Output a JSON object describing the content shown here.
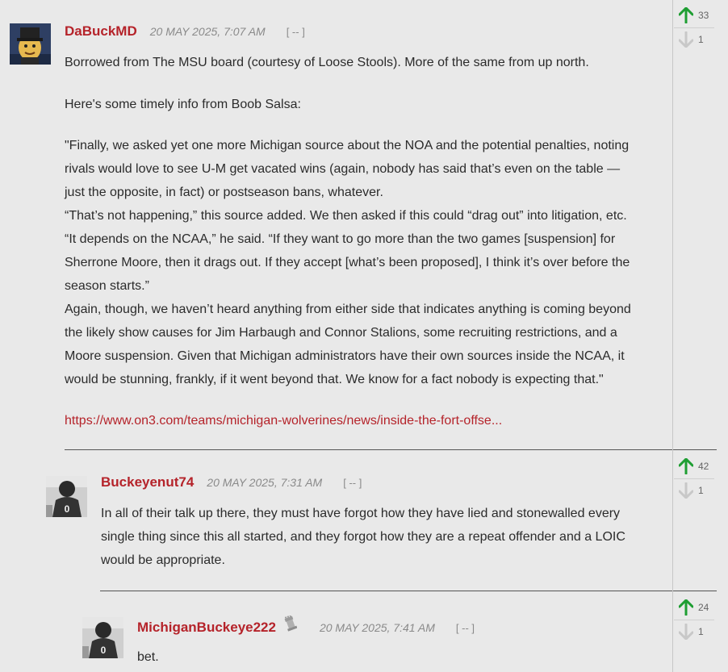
{
  "comments": [
    {
      "username": "DaBuckMD",
      "timestamp": "20 MAY 2025, 7:07 AM",
      "collapse": "[ -- ]",
      "paragraphs": [
        "Borrowed from The MSU board (courtesy of Loose Stools).  More of the same from up north.",
        "Here's some timely info from Boob Salsa:",
        "\"Finally, we asked yet one more Michigan source about the NOA and the potential penalties, noting rivals would love to see U-M get vacated wins (again, nobody has said that’s even on the table — just the opposite, in fact) or postseason bans, whatever.",
        "“That’s not happening,” this source added. We then asked if this could “drag out” into litigation, etc.",
        "“It depends on the NCAA,” he said. “If they want to go more than the two games [suspension] for Sherrone Moore, then it drags out. If they accept [what’s been proposed], I think it’s over before the season starts.”",
        "Again, though, we haven’t heard anything from either side that indicates anything is coming beyond the likely show causes for Jim Harbaugh and Connor Stalions, some recruiting restrictions, and a Moore suspension. Given that Michigan administrators have their own sources inside the NCAA, it would be stunning, frankly, if it went beyond that. We know for a fact nobody is expecting that.\""
      ],
      "link": "https://www.on3.com/teams/michigan-wolverines/news/inside-the-fort-offse...",
      "upvotes": "33",
      "downvotes": "1"
    },
    {
      "username": "Buckeyenut74",
      "timestamp": "20 MAY 2025, 7:31 AM",
      "collapse": "[ -- ]",
      "text": "In all of their talk up there, they must have forgot how they have lied and stonewalled every single thing since this all started, and they forgot how they are a repeat offender and a LOIC would be appropriate.",
      "upvotes": "42",
      "downvotes": "1"
    },
    {
      "username": "MichiganBuckeye222",
      "timestamp": "20 MAY 2025, 7:41 AM",
      "collapse": "[ -- ]",
      "text": "bet.",
      "upvotes": "24",
      "downvotes": "1"
    }
  ],
  "colors": {
    "username": "#b5232a",
    "upvote": "#1e9e32",
    "downvote": "#c8c8c8",
    "background": "#e9e9e9"
  },
  "icons": {
    "upvote": "arrow-up-icon",
    "downvote": "arrow-down-icon",
    "badge": "chess-rook-badge-icon"
  }
}
